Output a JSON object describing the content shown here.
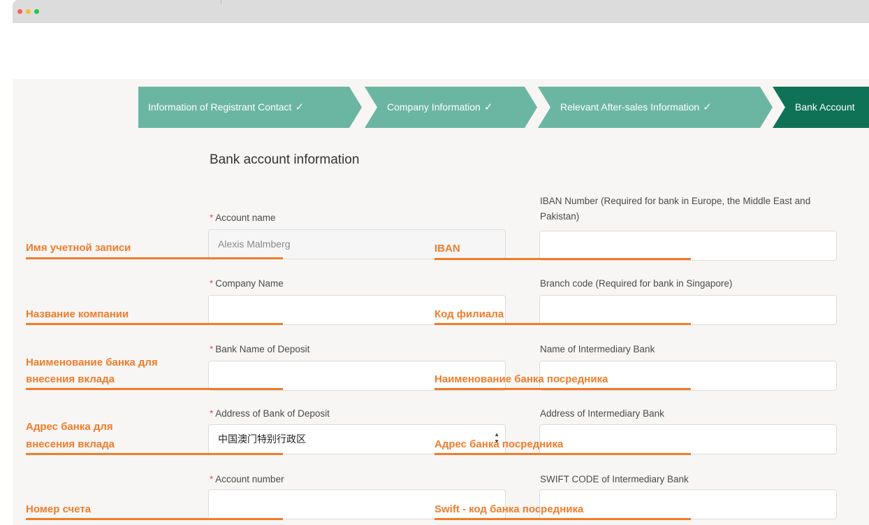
{
  "colors": {
    "step_done": "#6bb6a2",
    "step_active": "#0f7257",
    "annotation": "#f07c2a",
    "required": "#e05252"
  },
  "window": {
    "dots": [
      {
        "name": "close-dot",
        "color": "#ff5f57"
      },
      {
        "name": "minimize-dot",
        "color": "#febc2e"
      },
      {
        "name": "maximize-dot",
        "color": "#28c840"
      }
    ]
  },
  "steps": [
    {
      "label": "Information of Registrant Contact",
      "check": "✓",
      "status": "done"
    },
    {
      "label": "Company Information",
      "check": "✓",
      "status": "done"
    },
    {
      "label": "Relevant After-sales Information",
      "check": "✓",
      "status": "done"
    },
    {
      "label": "Bank Account",
      "check": "",
      "status": "active"
    }
  ],
  "form": {
    "title": "Bank account information",
    "required_mark": "*",
    "left": [
      {
        "label": "Account name",
        "value": "Alexis Malmberg",
        "required": true,
        "disabled": true
      },
      {
        "label": "Company Name",
        "value": "",
        "required": true
      },
      {
        "label": "Bank Name of Deposit",
        "value": "",
        "required": true
      },
      {
        "label": "Address of Bank of Deposit",
        "value": "中国澳门特别行政区",
        "required": true,
        "has_spinner": true,
        "spinner_up": "▲",
        "spinner_down": "▼"
      },
      {
        "label": "Account number",
        "value": "",
        "required": true
      }
    ],
    "right": [
      {
        "label": "IBAN Number (Required for bank in Europe, the Middle East and Pakistan)",
        "value": ""
      },
      {
        "label": "Branch code (Required for bank in Singapore)",
        "value": ""
      },
      {
        "label": "Name of Intermediary Bank",
        "value": ""
      },
      {
        "label": "Address of Intermediary Bank",
        "value": ""
      },
      {
        "label": "SWIFT CODE of Intermediary Bank",
        "value": ""
      }
    ]
  },
  "annotations": {
    "left": [
      {
        "line1": "Имя учетной записи",
        "line2": ""
      },
      {
        "line1": "Название компании",
        "line2": ""
      },
      {
        "line1": "Наименование банка для",
        "line2": "внесения вклада"
      },
      {
        "line1": "Адрес банка для",
        "line2": "внесения вклада"
      },
      {
        "line1": "Номер счета",
        "line2": ""
      }
    ],
    "right": [
      {
        "text": "IBAN"
      },
      {
        "text": "Код филиала"
      },
      {
        "text": "Наименование банка посредника"
      },
      {
        "text": "Адрес банка посредника"
      },
      {
        "text": "Swift - код банка посредника"
      }
    ]
  }
}
